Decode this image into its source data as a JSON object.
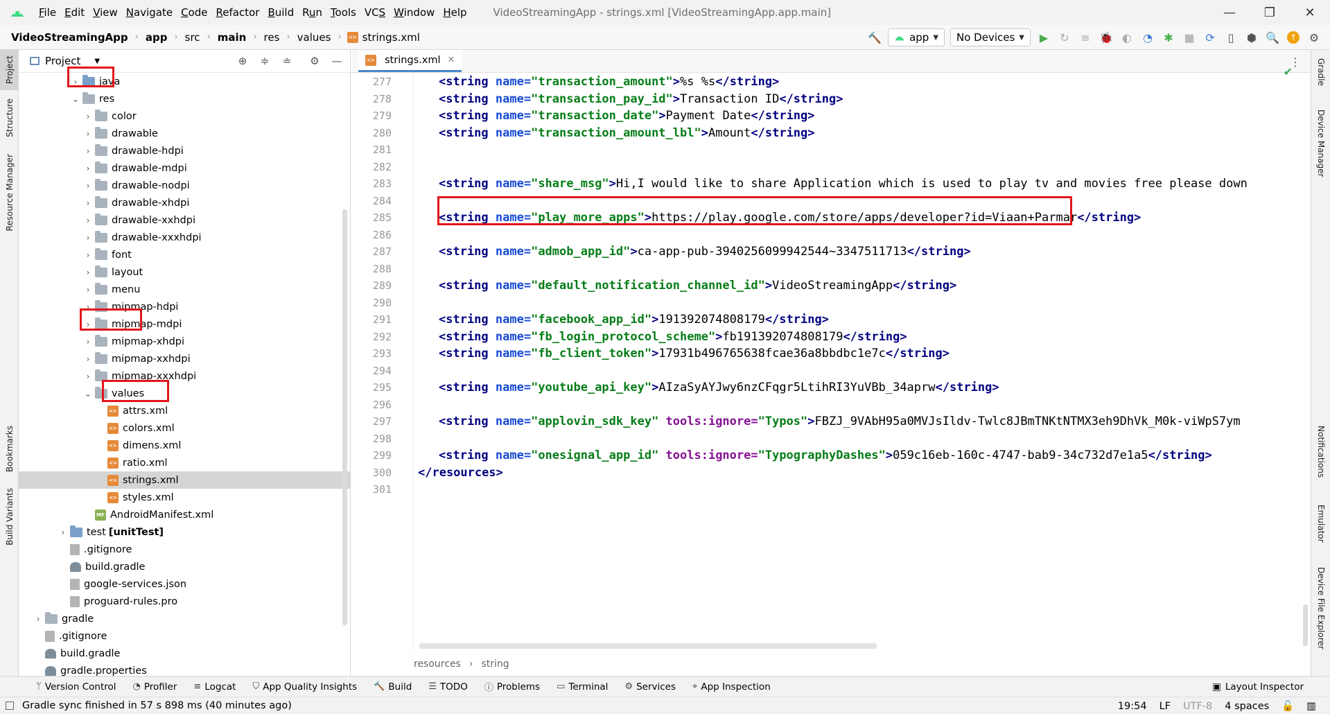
{
  "menubar": {
    "items": [
      {
        "label": "File",
        "mnemonic": "F"
      },
      {
        "label": "Edit",
        "mnemonic": "E"
      },
      {
        "label": "View",
        "mnemonic": "V"
      },
      {
        "label": "Navigate",
        "mnemonic": "N"
      },
      {
        "label": "Code",
        "mnemonic": "C"
      },
      {
        "label": "Refactor",
        "mnemonic": "R"
      },
      {
        "label": "Build",
        "mnemonic": "B"
      },
      {
        "label": "Run",
        "mnemonic": "u"
      },
      {
        "label": "Tools",
        "mnemonic": "T"
      },
      {
        "label": "VCS",
        "mnemonic": "S"
      },
      {
        "label": "Window",
        "mnemonic": "W"
      },
      {
        "label": "Help",
        "mnemonic": "H"
      }
    ],
    "window_title": "VideoStreamingApp - strings.xml [VideoStreamingApp.app.main]"
  },
  "breadcrumb": {
    "items": [
      "VideoStreamingApp",
      "app",
      "src",
      "main",
      "res",
      "values",
      "strings.xml"
    ]
  },
  "toolbar": {
    "run_config": "app",
    "device": "No Devices"
  },
  "left_strip": {
    "tabs": [
      "Project",
      "Structure",
      "Resource Manager",
      "Bookmarks",
      "Build Variants"
    ]
  },
  "right_strip": {
    "tabs": [
      "Gradle",
      "Device Manager",
      "Notifications",
      "Emulator",
      "Device File Explorer"
    ]
  },
  "project_panel": {
    "title": "Project",
    "tree": [
      {
        "label": "java",
        "depth": 4,
        "type": "folder-blue",
        "arrow": "right"
      },
      {
        "label": "res",
        "depth": 4,
        "type": "folder-res",
        "arrow": "down"
      },
      {
        "label": "color",
        "depth": 5,
        "type": "folder",
        "arrow": "right"
      },
      {
        "label": "drawable",
        "depth": 5,
        "type": "folder",
        "arrow": "right"
      },
      {
        "label": "drawable-hdpi",
        "depth": 5,
        "type": "folder",
        "arrow": "right"
      },
      {
        "label": "drawable-mdpi",
        "depth": 5,
        "type": "folder",
        "arrow": "right"
      },
      {
        "label": "drawable-nodpi",
        "depth": 5,
        "type": "folder",
        "arrow": "right"
      },
      {
        "label": "drawable-xhdpi",
        "depth": 5,
        "type": "folder",
        "arrow": "right"
      },
      {
        "label": "drawable-xxhdpi",
        "depth": 5,
        "type": "folder",
        "arrow": "right"
      },
      {
        "label": "drawable-xxxhdpi",
        "depth": 5,
        "type": "folder",
        "arrow": "right"
      },
      {
        "label": "font",
        "depth": 5,
        "type": "folder",
        "arrow": "right"
      },
      {
        "label": "layout",
        "depth": 5,
        "type": "folder",
        "arrow": "right"
      },
      {
        "label": "menu",
        "depth": 5,
        "type": "folder",
        "arrow": "right"
      },
      {
        "label": "mipmap-hdpi",
        "depth": 5,
        "type": "folder",
        "arrow": "right"
      },
      {
        "label": "mipmap-mdpi",
        "depth": 5,
        "type": "folder",
        "arrow": "right"
      },
      {
        "label": "mipmap-xhdpi",
        "depth": 5,
        "type": "folder",
        "arrow": "right"
      },
      {
        "label": "mipmap-xxhdpi",
        "depth": 5,
        "type": "folder",
        "arrow": "right"
      },
      {
        "label": "mipmap-xxxhdpi",
        "depth": 5,
        "type": "folder",
        "arrow": "right"
      },
      {
        "label": "values",
        "depth": 5,
        "type": "folder",
        "arrow": "down"
      },
      {
        "label": "attrs.xml",
        "depth": 6,
        "type": "xml",
        "arrow": "none"
      },
      {
        "label": "colors.xml",
        "depth": 6,
        "type": "xml",
        "arrow": "none"
      },
      {
        "label": "dimens.xml",
        "depth": 6,
        "type": "xml",
        "arrow": "none"
      },
      {
        "label": "ratio.xml",
        "depth": 6,
        "type": "xml",
        "arrow": "none"
      },
      {
        "label": "strings.xml",
        "depth": 6,
        "type": "xml",
        "arrow": "none",
        "selected": true
      },
      {
        "label": "styles.xml",
        "depth": 6,
        "type": "xml",
        "arrow": "none"
      },
      {
        "label": "AndroidManifest.xml",
        "depth": 5,
        "type": "manifest",
        "arrow": "none"
      },
      {
        "label": "test",
        "suffix": "[unitTest]",
        "depth": 3,
        "type": "folder-blue",
        "arrow": "right"
      },
      {
        "label": ".gitignore",
        "depth": 3,
        "type": "file",
        "arrow": "none"
      },
      {
        "label": "build.gradle",
        "depth": 3,
        "type": "gradle",
        "arrow": "none"
      },
      {
        "label": "google-services.json",
        "depth": 3,
        "type": "file",
        "arrow": "none"
      },
      {
        "label": "proguard-rules.pro",
        "depth": 3,
        "type": "file",
        "arrow": "none"
      },
      {
        "label": "gradle",
        "depth": 1,
        "type": "folder",
        "arrow": "right"
      },
      {
        "label": ".gitignore",
        "depth": 1,
        "type": "file",
        "arrow": "none"
      },
      {
        "label": "build.gradle",
        "depth": 1,
        "type": "gradle",
        "arrow": "none"
      },
      {
        "label": "gradle.properties",
        "depth": 1,
        "type": "gradle",
        "arrow": "none"
      }
    ]
  },
  "editor": {
    "tab_label": "strings.xml",
    "lines": [
      {
        "n": "277",
        "parts": [
          [
            "tag",
            "<string "
          ],
          [
            "attr",
            "name="
          ],
          [
            "val",
            "\"transaction_amount\""
          ],
          [
            "tag",
            ">"
          ],
          [
            "txt",
            "%s %s"
          ],
          [
            "tag",
            "</string>"
          ]
        ]
      },
      {
        "n": "278",
        "parts": [
          [
            "tag",
            "<string "
          ],
          [
            "attr",
            "name="
          ],
          [
            "val",
            "\"transaction_pay_id\""
          ],
          [
            "tag",
            ">"
          ],
          [
            "txt",
            "Transaction ID"
          ],
          [
            "tag",
            "</string>"
          ]
        ]
      },
      {
        "n": "279",
        "parts": [
          [
            "tag",
            "<string "
          ],
          [
            "attr",
            "name="
          ],
          [
            "val",
            "\"transaction_date\""
          ],
          [
            "tag",
            ">"
          ],
          [
            "txt",
            "Payment Date"
          ],
          [
            "tag",
            "</string>"
          ]
        ]
      },
      {
        "n": "280",
        "parts": [
          [
            "tag",
            "<string "
          ],
          [
            "attr",
            "name="
          ],
          [
            "val",
            "\"transaction_amount_lbl\""
          ],
          [
            "tag",
            ">"
          ],
          [
            "txt",
            "Amount"
          ],
          [
            "tag",
            "</string>"
          ]
        ]
      },
      {
        "n": "281",
        "parts": []
      },
      {
        "n": "282",
        "parts": []
      },
      {
        "n": "283",
        "parts": [
          [
            "tag",
            "<string "
          ],
          [
            "attr",
            "name="
          ],
          [
            "val",
            "\"share_msg\""
          ],
          [
            "tag",
            ">"
          ],
          [
            "txt",
            "Hi,I would like to share Application which is used to play tv and movies free please down"
          ]
        ]
      },
      {
        "n": "284",
        "parts": []
      },
      {
        "n": "285",
        "parts": [
          [
            "tag",
            "<string "
          ],
          [
            "attr",
            "name="
          ],
          [
            "val",
            "\"play_more_apps\""
          ],
          [
            "tag",
            ">"
          ],
          [
            "txt",
            "https://play.google.com/store/apps/developer?id=Viaan+Parmar"
          ],
          [
            "tag",
            "</string>"
          ]
        ]
      },
      {
        "n": "286",
        "parts": []
      },
      {
        "n": "287",
        "parts": [
          [
            "tag",
            "<string "
          ],
          [
            "attr",
            "name="
          ],
          [
            "val",
            "\"admob_app_id\""
          ],
          [
            "tag",
            ">"
          ],
          [
            "txt",
            "ca-app-pub-3940256099942544~3347511713"
          ],
          [
            "tag",
            "</string>"
          ]
        ]
      },
      {
        "n": "288",
        "parts": []
      },
      {
        "n": "289",
        "parts": [
          [
            "tag",
            "<string "
          ],
          [
            "attr",
            "name="
          ],
          [
            "val",
            "\"default_notification_channel_id\""
          ],
          [
            "tag",
            ">"
          ],
          [
            "txt",
            "VideoStreamingApp"
          ],
          [
            "tag",
            "</string>"
          ]
        ]
      },
      {
        "n": "290",
        "parts": []
      },
      {
        "n": "291",
        "parts": [
          [
            "tag",
            "<string "
          ],
          [
            "attr",
            "name="
          ],
          [
            "val",
            "\"facebook_app_id\""
          ],
          [
            "tag",
            ">"
          ],
          [
            "txt",
            "191392074808179"
          ],
          [
            "tag",
            "</string>"
          ]
        ]
      },
      {
        "n": "292",
        "parts": [
          [
            "tag",
            "<string "
          ],
          [
            "attr",
            "name="
          ],
          [
            "val",
            "\"fb_login_protocol_scheme\""
          ],
          [
            "tag",
            ">"
          ],
          [
            "txt",
            "fb191392074808179"
          ],
          [
            "tag",
            "</string>"
          ]
        ]
      },
      {
        "n": "293",
        "parts": [
          [
            "tag",
            "<string "
          ],
          [
            "attr",
            "name="
          ],
          [
            "val",
            "\"fb_client_token\""
          ],
          [
            "tag",
            ">"
          ],
          [
            "txt",
            "17931b496765638fcae36a8bbdbc1e7c"
          ],
          [
            "tag",
            "</string>"
          ]
        ]
      },
      {
        "n": "294",
        "parts": []
      },
      {
        "n": "295",
        "parts": [
          [
            "tag",
            "<string "
          ],
          [
            "attr",
            "name="
          ],
          [
            "val",
            "\"youtube_api_key\""
          ],
          [
            "tag",
            ">"
          ],
          [
            "txt",
            "AIzaSyAYJwy6nzCFqgr5LtihRI3YuVBb_34aprw"
          ],
          [
            "tag",
            "</string>"
          ]
        ]
      },
      {
        "n": "296",
        "parts": []
      },
      {
        "n": "297",
        "parts": [
          [
            "tag",
            "<string "
          ],
          [
            "attr",
            "name="
          ],
          [
            "val",
            "\"applovin_sdk_key\" "
          ],
          [
            "ns",
            "tools:ignore="
          ],
          [
            "val",
            "\"Typos\""
          ],
          [
            "tag",
            ">"
          ],
          [
            "txt",
            "FBZJ_9VAbH95a0MVJsIldv-Twlc8JBmTNKtNTMX3eh9DhVk_M0k-viWpS7ym"
          ]
        ]
      },
      {
        "n": "298",
        "parts": []
      },
      {
        "n": "299",
        "parts": [
          [
            "tag",
            "<string "
          ],
          [
            "attr",
            "name="
          ],
          [
            "val",
            "\"onesignal_app_id\" "
          ],
          [
            "ns",
            "tools:ignore="
          ],
          [
            "val",
            "\"TypographyDashes\""
          ],
          [
            "tag",
            ">"
          ],
          [
            "txt",
            "059c16eb-160c-4747-bab9-34c732d7e1a5"
          ],
          [
            "tag",
            "</string>"
          ]
        ]
      },
      {
        "n": "300",
        "parts": [
          [
            "tag",
            "</resources>"
          ]
        ],
        "indent": "root"
      },
      {
        "n": "301",
        "parts": []
      }
    ],
    "breadcrumb": [
      "resources",
      "string"
    ]
  },
  "bottom_bar": {
    "tabs": [
      "Version Control",
      "Profiler",
      "Logcat",
      "App Quality Insights",
      "Build",
      "TODO",
      "Problems",
      "Terminal",
      "Services",
      "App Inspection"
    ],
    "right_tab": "Layout Inspector"
  },
  "status": {
    "message": "Gradle sync finished in 57 s 898 ms (40 minutes ago)",
    "position": "19:54",
    "line_sep": "LF",
    "encoding": "UTF-8",
    "indent": "4 spaces"
  },
  "colors": {
    "highlight_box": "#e3151b",
    "tag": "#000080",
    "attr": "#174ad4",
    "value": "#067d17"
  }
}
